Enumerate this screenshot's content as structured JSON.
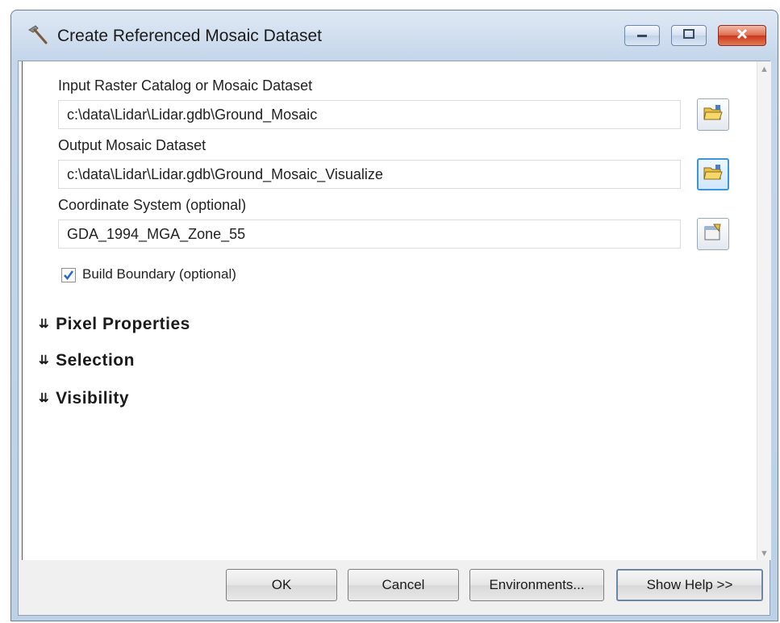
{
  "window": {
    "title": "Create Referenced Mosaic Dataset"
  },
  "form": {
    "input": {
      "label": "Input Raster Catalog or Mosaic Dataset",
      "value": "c:\\data\\Lidar\\Lidar.gdb\\Ground_Mosaic"
    },
    "output": {
      "label": "Output Mosaic Dataset",
      "value": "c:\\data\\Lidar\\Lidar.gdb\\Ground_Mosaic_Visualize"
    },
    "coordinate": {
      "label": "Coordinate System (optional)",
      "value": "GDA_1994_MGA_Zone_55"
    },
    "build_boundary": {
      "label": "Build Boundary (optional)",
      "checked": true
    }
  },
  "sections": [
    {
      "label": "Pixel Properties"
    },
    {
      "label": "Selection"
    },
    {
      "label": "Visibility"
    }
  ],
  "buttons": {
    "ok": "OK",
    "cancel": "Cancel",
    "environments": "Environments...",
    "help": "Show Help >>"
  },
  "colors": {
    "title_gradient": "#c5d6ea",
    "close_button": "#c9381c",
    "checkbox_check": "#2a66c8",
    "folder_icon": "#e8c04a"
  },
  "icons": [
    "hammer-tool-icon",
    "folder-open-icon",
    "coordinate-properties-icon"
  ]
}
